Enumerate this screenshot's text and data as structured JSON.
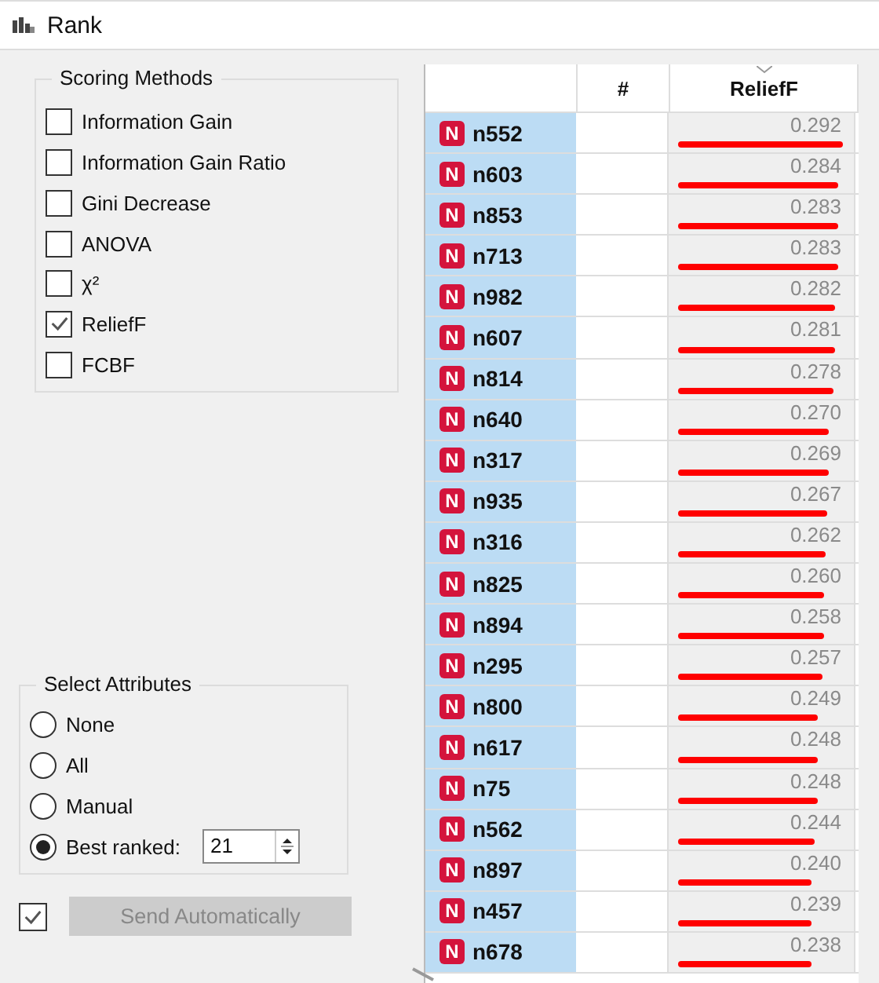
{
  "window": {
    "title": "Rank"
  },
  "scoring_methods": {
    "title": "Scoring Methods",
    "items": [
      {
        "label": "Information Gain",
        "checked": false
      },
      {
        "label": "Information Gain Ratio",
        "checked": false
      },
      {
        "label": "Gini Decrease",
        "checked": false
      },
      {
        "label": "ANOVA",
        "checked": false
      },
      {
        "label": "χ²",
        "checked": false
      },
      {
        "label": "ReliefF",
        "checked": true
      },
      {
        "label": "FCBF",
        "checked": false
      }
    ]
  },
  "select_attributes": {
    "title": "Select Attributes",
    "options": [
      {
        "label": "None",
        "selected": false
      },
      {
        "label": "All",
        "selected": false
      },
      {
        "label": "Manual",
        "selected": false
      },
      {
        "label": "Best ranked:",
        "selected": true
      }
    ],
    "best_ranked_value": "21"
  },
  "send_automatically": {
    "checked": true,
    "label": "Send Automatically",
    "disabled": true
  },
  "table": {
    "columns": [
      "#",
      "ReliefF"
    ],
    "rows": [
      {
        "badge": "N",
        "name": "n552",
        "value": "0.292",
        "level": 0.97
      },
      {
        "badge": "N",
        "name": "n603",
        "value": "0.284",
        "level": 0.94
      },
      {
        "badge": "N",
        "name": "n853",
        "value": "0.283",
        "level": 0.94
      },
      {
        "badge": "N",
        "name": "n713",
        "value": "0.283",
        "level": 0.94
      },
      {
        "badge": "N",
        "name": "n982",
        "value": "0.282",
        "level": 0.93
      },
      {
        "badge": "N",
        "name": "n607",
        "value": "0.281",
        "level": 0.93
      },
      {
        "badge": "N",
        "name": "n814",
        "value": "0.278",
        "level": 0.92
      },
      {
        "badge": "N",
        "name": "n640",
        "value": "0.270",
        "level": 0.89
      },
      {
        "badge": "N",
        "name": "n317",
        "value": "0.269",
        "level": 0.89
      },
      {
        "badge": "N",
        "name": "n935",
        "value": "0.267",
        "level": 0.88
      },
      {
        "badge": "N",
        "name": "n316",
        "value": "0.262",
        "level": 0.87
      },
      {
        "badge": "N",
        "name": "n825",
        "value": "0.260",
        "level": 0.86
      },
      {
        "badge": "N",
        "name": "n894",
        "value": "0.258",
        "level": 0.86
      },
      {
        "badge": "N",
        "name": "n295",
        "value": "0.257",
        "level": 0.85
      },
      {
        "badge": "N",
        "name": "n800",
        "value": "0.249",
        "level": 0.82
      },
      {
        "badge": "N",
        "name": "n617",
        "value": "0.248",
        "level": 0.82
      },
      {
        "badge": "N",
        "name": "n75",
        "value": "0.248",
        "level": 0.82
      },
      {
        "badge": "N",
        "name": "n562",
        "value": "0.244",
        "level": 0.81
      },
      {
        "badge": "N",
        "name": "n897",
        "value": "0.240",
        "level": 0.79
      },
      {
        "badge": "N",
        "name": "n457",
        "value": "0.239",
        "level": 0.79
      },
      {
        "badge": "N",
        "name": "n678",
        "value": "0.238",
        "level": 0.79
      }
    ]
  }
}
